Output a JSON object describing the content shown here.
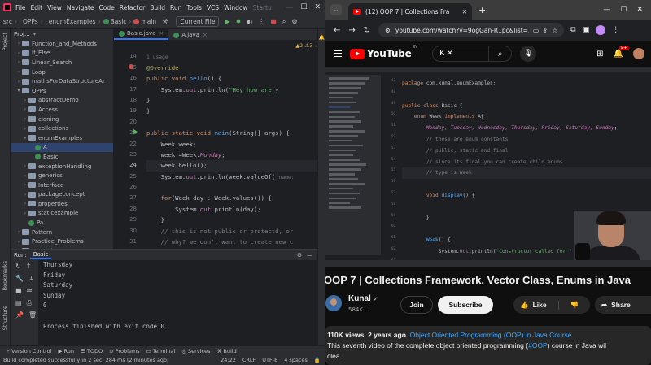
{
  "ide": {
    "menu": [
      "File",
      "Edit",
      "View",
      "Navigate",
      "Code",
      "Refactor",
      "Build",
      "Run",
      "Tools",
      "VCS",
      "Window"
    ],
    "menu_trailing": "Startu",
    "breadcrumbs": [
      "src",
      "OPPs",
      "enumExamples",
      "Basic",
      "main"
    ],
    "run_config": "Current File",
    "left_strip": [
      "Project",
      "Bookmarks",
      "Structure"
    ],
    "project": {
      "header": "Proj...",
      "items": [
        {
          "label": "Function_and_Methods",
          "kind": "folder",
          "indent": 2
        },
        {
          "label": "If_Else",
          "kind": "folder",
          "indent": 2
        },
        {
          "label": "Linear_Search",
          "kind": "folder",
          "indent": 2
        },
        {
          "label": "Loop",
          "kind": "folder",
          "indent": 2
        },
        {
          "label": "mathsForDataStructureAr",
          "kind": "folder",
          "indent": 2
        },
        {
          "label": "OPPs",
          "kind": "folder",
          "indent": 2,
          "open": true
        },
        {
          "label": "abstractDemo",
          "kind": "folder",
          "indent": 3
        },
        {
          "label": "Access",
          "kind": "folder",
          "indent": 3
        },
        {
          "label": "cloning",
          "kind": "folder",
          "indent": 3
        },
        {
          "label": "collections",
          "kind": "folder",
          "indent": 3
        },
        {
          "label": "enumExamples",
          "kind": "folder",
          "indent": 3,
          "open": true
        },
        {
          "label": "A",
          "kind": "class",
          "indent": 4,
          "selected": true
        },
        {
          "label": "Basic",
          "kind": "class",
          "indent": 4
        },
        {
          "label": "exceptionHandling",
          "kind": "folder",
          "indent": 3
        },
        {
          "label": "generics",
          "kind": "folder",
          "indent": 3
        },
        {
          "label": "Interface",
          "kind": "folder",
          "indent": 3
        },
        {
          "label": "packageconcept",
          "kind": "folder",
          "indent": 3
        },
        {
          "label": "properties",
          "kind": "folder",
          "indent": 3
        },
        {
          "label": "staticexample",
          "kind": "folder",
          "indent": 3
        },
        {
          "label": "Pa",
          "kind": "class",
          "indent": 3
        },
        {
          "label": "Pattern",
          "kind": "folder",
          "indent": 2
        },
        {
          "label": "Practice_Problems",
          "kind": "folder",
          "indent": 2
        },
        {
          "label": "Recursion",
          "kind": "folder",
          "indent": 2
        }
      ]
    },
    "tabs": [
      {
        "label": "Basic.java",
        "active": true
      },
      {
        "label": "A.java",
        "active": false
      }
    ],
    "warnings": "▲2  ⚠3  ✓6",
    "line_numbers": [
      "14",
      "15",
      "16",
      "17",
      "18",
      "19",
      "20",
      "21",
      "22",
      "23",
      "24",
      "25",
      "26",
      "27",
      "28",
      "29",
      "30",
      "31",
      "32"
    ],
    "usage_hint": "1 usage",
    "param_hint": "name:",
    "run_panel": {
      "label": "Run:",
      "tab": "Basic",
      "output": [
        "Thursday",
        "Friday",
        "Saturday",
        "Sunday",
        "0",
        "",
        "Process finished with exit code 0"
      ]
    },
    "bottom_tools": [
      "Version Control",
      "Run",
      "TODO",
      "Problems",
      "Terminal",
      "Services",
      "Build"
    ],
    "status": {
      "message": "Build completed successfully in 2 sec, 284 ms (2 minutes ago)",
      "position": "24:22",
      "line_sep": "CRLF",
      "encoding": "UTF-8",
      "indent": "4 spaces"
    }
  },
  "browser": {
    "tab_title": "(12) OOP 7 | Collections Fra",
    "url": "youtube.com/watch?v=9ogGan-R1pc&list=...",
    "youtube": {
      "country": "IN",
      "search_text": "K",
      "notif_count": "9+",
      "video_title": "OOP 7 | Collections Framework, Vector Class, Enums in Java",
      "channel": "Kunal",
      "subscribers": "584K...",
      "join": "Join",
      "subscribe": "Subscribe",
      "like": "Like",
      "share": "Share",
      "views": "110K views",
      "age": "2 years ago",
      "playlist": "Object Oriented Programming (OOP) in Java Course",
      "desc_prefix": "This seventh video of the complete object oriented programming (",
      "desc_tag": "#OOP",
      "desc_suffix": ") course in Java wil",
      "desc_line3": "clea",
      "video_lines": [
        "47",
        "48",
        "49",
        "50",
        "51",
        "52",
        "53",
        "54",
        "55",
        "56",
        "57",
        "58",
        "59",
        "60",
        "61",
        "62",
        "63"
      ]
    }
  },
  "colors": {
    "ide_bg": "#1e1f22",
    "ide_panel": "#2b2d30",
    "keyword": "#cf8e6d",
    "method": "#56a8f5",
    "string": "#6aab73",
    "youtube_red": "#ff0000",
    "link": "#3ea6ff"
  }
}
